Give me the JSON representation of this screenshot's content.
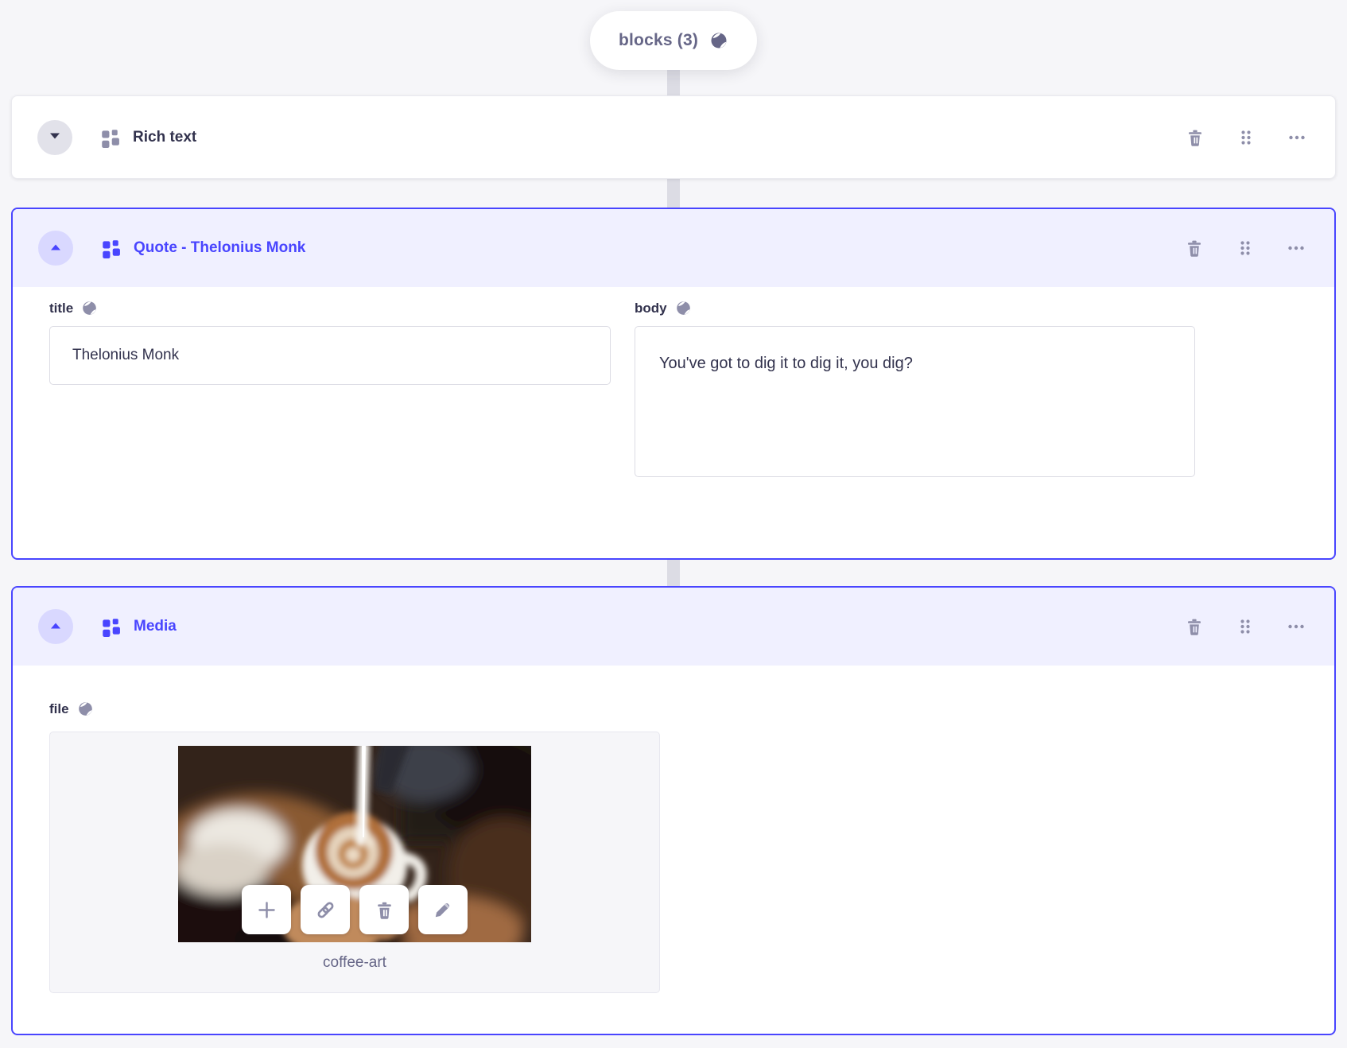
{
  "pill": {
    "label": "blocks (3)"
  },
  "blocks": [
    {
      "title": "Rich text",
      "state": "collapsed"
    },
    {
      "title": "Quote - Thelonius Monk",
      "state": "expanded",
      "fields": [
        {
          "label": "title",
          "type": "text-input",
          "value": "Thelonius Monk"
        },
        {
          "label": "body",
          "type": "textarea",
          "value": "You've got to dig it to dig it, you dig?"
        }
      ]
    },
    {
      "title": "Media",
      "state": "expanded",
      "fields": [
        {
          "label": "file",
          "type": "media",
          "file_name": "coffee-art"
        }
      ]
    }
  ],
  "icons": {
    "pill": "globe-icon",
    "collapsed_toggle": "chevron-down-icon",
    "expanded_toggle": "chevron-up-icon",
    "block_type": "component-grid-icon",
    "row_actions": [
      "trash-icon",
      "drag-dots-icon",
      "ellipsis-icon"
    ],
    "asset_actions": [
      "plus-icon",
      "link-icon",
      "trash-icon",
      "pencil-icon"
    ]
  },
  "colors": {
    "primary": "#4945FF",
    "header_bg": "#F0F0FF",
    "text_dark": "#32324D",
    "text_gray": "#666687",
    "icon_gray": "#8E8EA9",
    "connector": "#DCDCE4",
    "page_bg": "#F6F6F9"
  }
}
